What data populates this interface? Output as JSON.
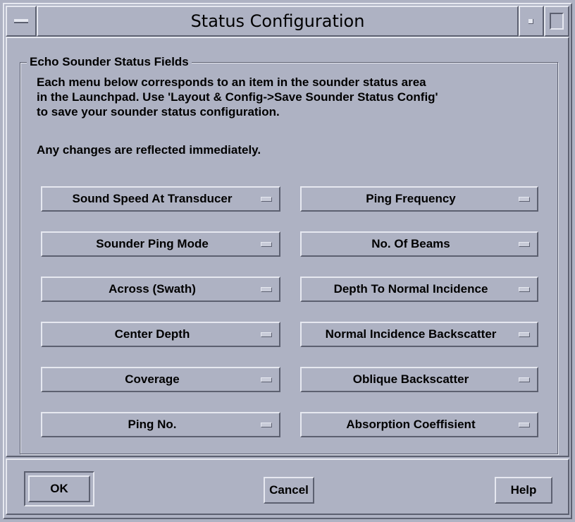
{
  "window": {
    "title": "Status Configuration"
  },
  "group": {
    "title": "Echo Sounder Status Fields",
    "description_lines": [
      "Each menu below corresponds to an item in the sounder status area",
      "in the Launchpad. Use 'Layout & Config->Save Sounder Status Config'",
      "to save your sounder status configuration."
    ],
    "note": "Any changes are reflected immediately."
  },
  "fields": {
    "left": [
      "Sound Speed At Transducer",
      "Sounder Ping Mode",
      "Across (Swath)",
      "Center Depth",
      "Coverage",
      "Ping No."
    ],
    "right": [
      "Ping Frequency",
      "No. Of Beams",
      "Depth To Normal Incidence",
      "Normal Incidence Backscatter",
      "Oblique Backscatter",
      "Absorption Coeffisient"
    ]
  },
  "actions": {
    "ok_label": "OK",
    "cancel_label": "Cancel",
    "help_label": "Help"
  }
}
